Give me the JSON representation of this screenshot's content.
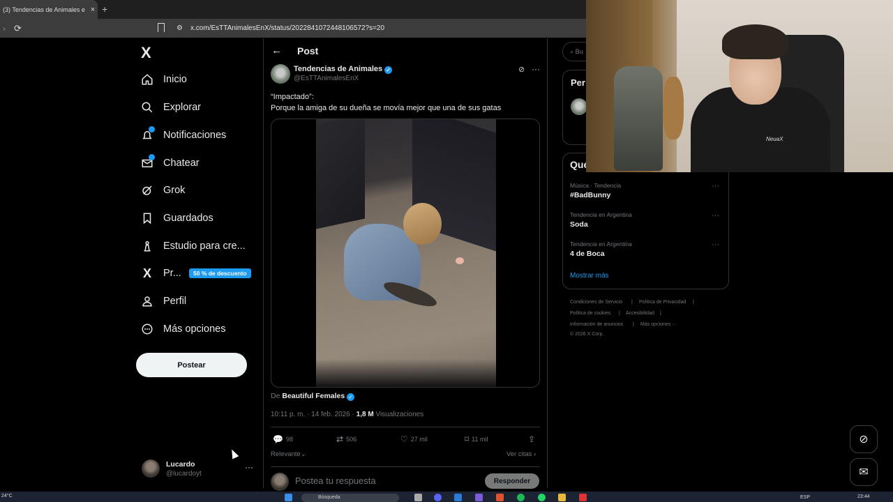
{
  "browser": {
    "tab_title": "(3) Tendencias de Animales e",
    "tab_close": "×",
    "new_tab": "+",
    "url": "x.com/EsTTAnimalesEnX/status/2022841072448106572?s=20"
  },
  "sidebar": {
    "logo": "X",
    "items": [
      {
        "label": "Inicio",
        "icon": "home-icon"
      },
      {
        "label": "Explorar",
        "icon": "search-icon"
      },
      {
        "label": "Notificaciones",
        "icon": "bell-icon"
      },
      {
        "label": "Chatear",
        "icon": "mail-icon"
      },
      {
        "label": "Grok",
        "icon": "grok-icon"
      },
      {
        "label": "Guardados",
        "icon": "bookmark-icon"
      },
      {
        "label": "Estudio para cre...",
        "icon": "studio-icon"
      },
      {
        "label": "Pr...",
        "icon": "x-premium-icon"
      },
      {
        "label": "Perfil",
        "icon": "person-icon"
      },
      {
        "label": "Más opciones",
        "icon": "more-circle-icon"
      }
    ],
    "premium_badge": "50 % de descuento",
    "post_button": "Postear",
    "account": {
      "name": "Lucardo",
      "handle": "@lucardoyt",
      "more": "···"
    }
  },
  "post": {
    "header_title": "Post",
    "author_name": "Tendencias de Animales",
    "author_handle": "@EsTTAnimalesEnX",
    "text_line1": "“Impactado”:",
    "text_line2": "Porque la amiga de su dueña se movía mejor que una de sus gatas",
    "source_prefix": "De",
    "source_name": "Beautiful Females",
    "time": "10:11 p. m. · 14 feb. 2026 · ",
    "views_count": "1,8 M",
    "views_label": " Visualizaciones",
    "replies": "98",
    "reposts": "506",
    "likes": "27 mil",
    "bookmarks": "11 mil",
    "sort_label": "Relevante",
    "quotes_label": "Ver citas",
    "reply_placeholder": "Postea tu respuesta",
    "reply_button": "Responder"
  },
  "right": {
    "search_placeholder": "Bu",
    "premium_title": "Per",
    "trends_title": "Qué",
    "trends": [
      {
        "meta": "Música · Tendencia",
        "name": "#BadBunny"
      },
      {
        "meta": "Tendencia en Argentina",
        "name": "Soda"
      },
      {
        "meta": "Tendencia en Argentina",
        "name": "4 de Boca"
      }
    ],
    "show_more": "Mostrar más",
    "footer": {
      "terms": "Condiciones de Servicio",
      "privacy": "Política de Privacidad",
      "cookies": "Política de cookies",
      "accessibility": "Accesibilidad",
      "ads": "Información de anuncios",
      "more": "Más opciones ···",
      "copyright": "© 2026 X Corp."
    }
  },
  "webcam": {
    "shirt_logo": "NeuaX"
  },
  "taskbar": {
    "temperature": "24°C",
    "search": "Búsqueda",
    "lang": "ESP",
    "clock": "23:44"
  },
  "colors": {
    "accent": "#1d9bf0",
    "background": "#000000",
    "border": "#2f3336",
    "muted": "#71767b"
  }
}
